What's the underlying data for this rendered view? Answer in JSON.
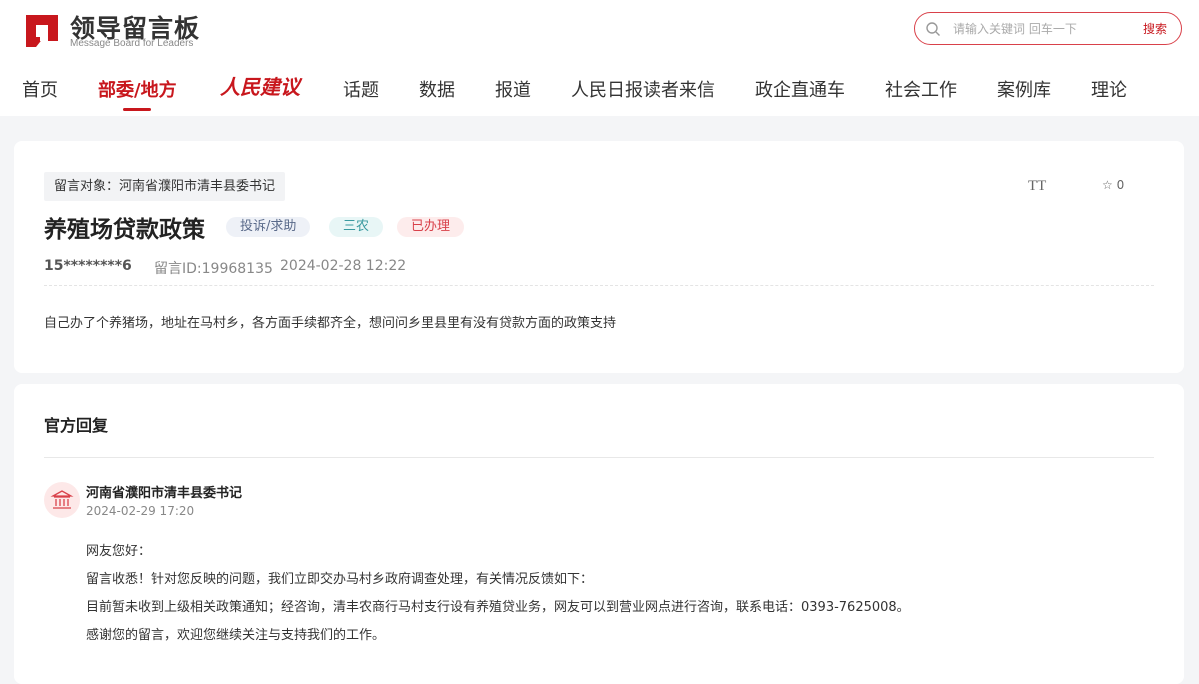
{
  "site": {
    "logo_cn": "领导留言板",
    "logo_en": "Message Board for Leaders",
    "brand_color": "#c8171d"
  },
  "search": {
    "placeholder": "请输入关键词 回车一下",
    "button": "搜索",
    "icon": "search-icon"
  },
  "nav": {
    "items": [
      "首页",
      "部委/地方",
      "人民建议",
      "话题",
      "数据",
      "报道",
      "人民日报读者来信",
      "政企直通车",
      "社会工作",
      "案例库",
      "理论"
    ],
    "active": "部委/地方"
  },
  "message": {
    "target_label": "留言对象：河南省濮阳市清丰县委书记",
    "title": "养殖场贷款政策",
    "tags": [
      "投诉/求助",
      "三农",
      "已办理"
    ],
    "author": "15********6",
    "id_label": "留言ID:19968135",
    "datetime": "2024-02-28 12:22",
    "favorite_count": "0",
    "font_size_icon": "TT",
    "content": "自己办了个养猪场，地址在马村乡，各方面手续都齐全，想问问乡里县里有没有贷款方面的政策支持"
  },
  "reply": {
    "section_title": "官方回复",
    "org_name": "河南省濮阳市清丰县委书记",
    "datetime": "2024-02-29 17:20",
    "lines": [
      "网友您好：",
      "留言收悉！针对您反映的问题，我们立即交办马村乡政府调查处理，有关情况反馈如下：",
      "目前暂未收到上级相关政策通知；经咨询，清丰农商行马村支行设有养殖贷业务，网友可以到营业网点进行咨询，联系电话：0393-7625008。",
      "感谢您的留言，欢迎您继续关注与支持我们的工作。"
    ]
  }
}
